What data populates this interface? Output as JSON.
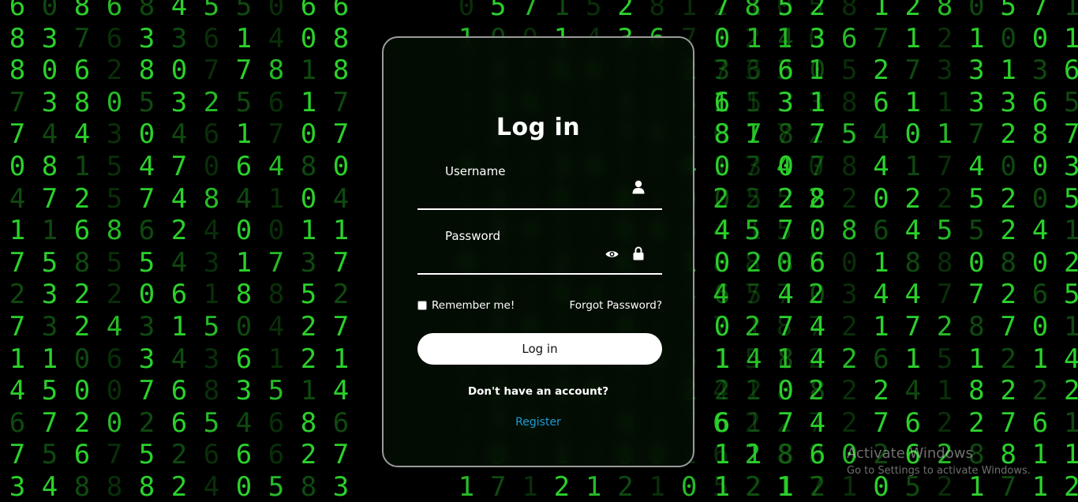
{
  "login": {
    "title": "Log in",
    "username_label": "Username",
    "password_label": "Password",
    "remember_label": "Remember me!",
    "forgot_label": "Forgot Password?",
    "submit_label": "Log in",
    "no_account_text": "Don't have an account?",
    "register_label": "Register"
  },
  "icons": {
    "username": "user-icon",
    "password_toggle": "eye-icon",
    "password": "lock-icon"
  },
  "colors": {
    "matrix_green": "#2bd12b",
    "register_link": "#1e9bd7",
    "card_border": "#9a9a9a"
  },
  "watermark": {
    "line1": "Activate Windows",
    "line2": "Go to Settings to activate Windows."
  },
  "background": {
    "digit_rows": [
      "6086845506",
      "8376336140",
      "8062807781",
      "7380532561",
      "7443046170",
      "0815470648",
      "4725748410",
      "1168624001",
      "7585543173",
      "2322061885",
      "7324315042",
      "1106343612",
      "4500768351",
      "6720265468",
      "7567526662",
      "3488824058",
      "8057152812",
      "2100143671",
      "3313660527",
      "1336531861",
      "1728787540",
      "7400307841",
      "2520528202",
      "5524170864",
      "8080286018",
      "7726540344",
      "2870174217",
      "5121484261",
      "1822208224",
      "2276174276",
      "2881186026",
      "2171212105"
    ]
  }
}
